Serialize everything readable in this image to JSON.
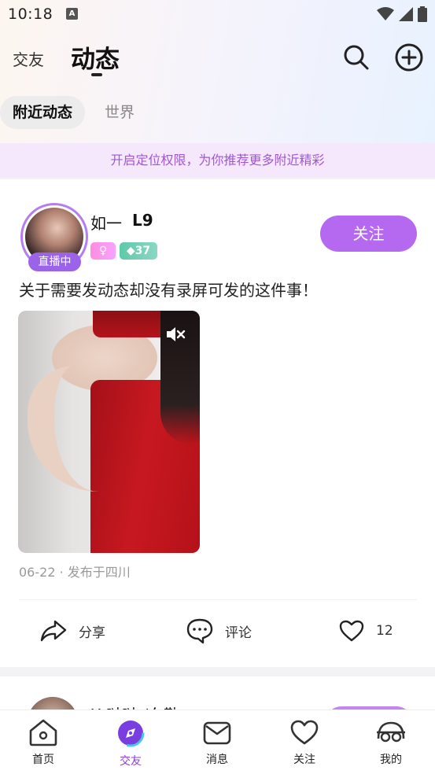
{
  "status_bar": {
    "time": "10:18",
    "notification_letter": "A"
  },
  "header": {
    "tabs": [
      {
        "label": "交友",
        "active": false
      },
      {
        "label": "动态",
        "active": true
      }
    ],
    "search_icon": "search-icon",
    "add_icon": "plus-circle-icon"
  },
  "sub_tabs": [
    {
      "label": "附近动态",
      "active": true
    },
    {
      "label": "世界",
      "active": false
    }
  ],
  "permission_banner": "开启定位权限，为你推荐更多附近精彩",
  "post": {
    "user_name": "如一",
    "user_level": "L9",
    "live_badge": "直播中",
    "gender_badge": "♀",
    "rank_badge": "◆37",
    "follow_label": "关注",
    "text": "关于需要发动态却没有录屏可发的这件事！",
    "meta": "06-22 · 发布于四川",
    "actions": {
      "share": "分享",
      "comment": "评论",
      "like_count": "12"
    }
  },
  "next_post": {
    "user_name": "X 哒哒 /东勒"
  },
  "bottom_nav": [
    {
      "label": "首页",
      "icon": "home-icon",
      "active": false
    },
    {
      "label": "交友",
      "icon": "compass-icon",
      "active": true
    },
    {
      "label": "消息",
      "icon": "mail-icon",
      "active": false
    },
    {
      "label": "关注",
      "icon": "heart-icon",
      "active": false
    },
    {
      "label": "我的",
      "icon": "profile-icon",
      "active": false
    }
  ],
  "colors": {
    "accent": "#b569f0",
    "active_nav": "#8a3ee0",
    "banner_text": "#a056d8"
  }
}
